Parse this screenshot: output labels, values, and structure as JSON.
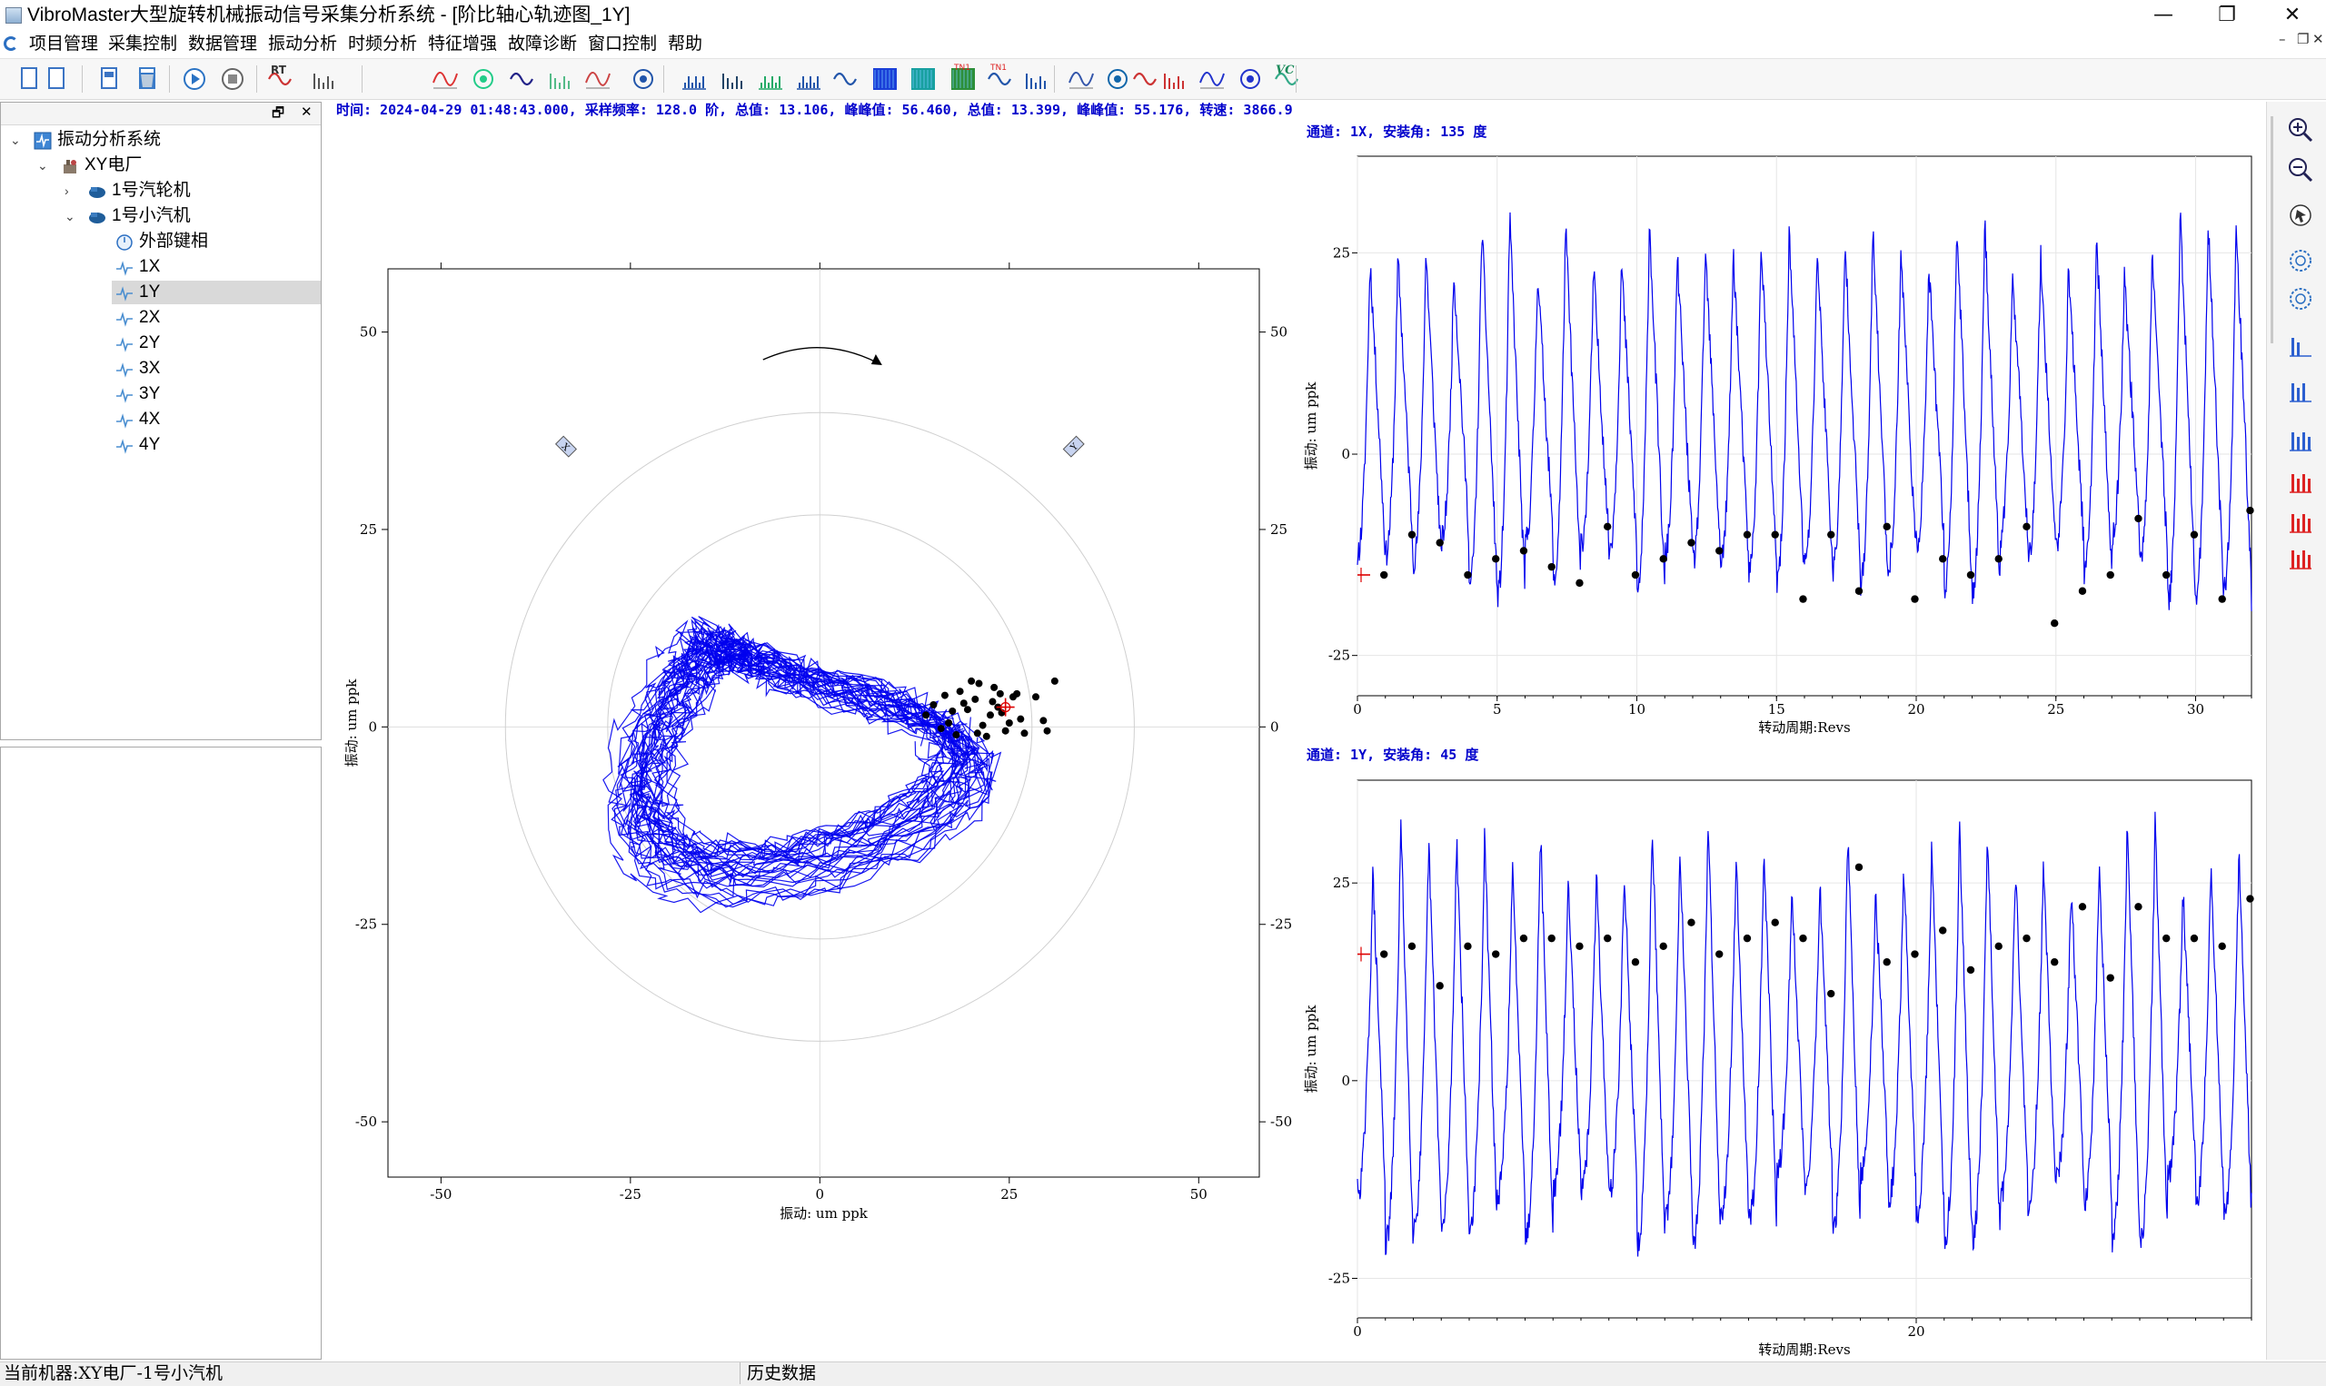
{
  "window": {
    "title": "VibroMaster大型旋转机械振动信号采集分析系统 - [阶比轴心轨迹图_1Y]",
    "minimize_glyph": "—",
    "restore_glyph": "❐",
    "close_glyph": "✕"
  },
  "menu": {
    "items": [
      "项目管理",
      "采集控制",
      "数据管理",
      "振动分析",
      "时频分析",
      "特征增强",
      "故障诊断",
      "窗口控制",
      "帮助"
    ],
    "mdi_minimize_glyph": "–",
    "mdi_restore_glyph": "❐",
    "mdi_close_glyph": "✕"
  },
  "toolbar": {
    "icons": [
      "new-project-icon",
      "open-project-icon",
      "save-icon",
      "delete-icon",
      "start-acquisition-icon",
      "stop-acquisition-icon",
      "realtime-icon",
      "history-icon",
      "trend-icon",
      "multi-trend-icon",
      "bode-icon",
      "polar-icon",
      "orbit-icon",
      "waveform-icon",
      "spectrum-icon",
      "waterfall-icon",
      "cascade-icon",
      "multi-spectrum-icon",
      "multi-waveform-icon",
      "stft-icon",
      "wavelet-icon",
      "spectrogram-icon",
      "order-waveform-icon",
      "order-spectrum-icon",
      "shaft-orbit-icon",
      "full-spectrum-icon",
      "filter-icon",
      "envelope-icon",
      "hilbert-icon",
      "cepstrum-icon",
      "vc-icon"
    ],
    "labels": {
      "rt": "RT",
      "vc": "VC",
      "order_wave": "TN1",
      "order_spec": "TN1"
    }
  },
  "tree": {
    "panel_float_glyph": "🗗",
    "panel_close_glyph": "✕",
    "nodes": [
      {
        "label": "振动分析系统",
        "level": 0,
        "expanded": true,
        "icon": "system-icon",
        "selected": false
      },
      {
        "label": "XY电厂",
        "level": 1,
        "expanded": true,
        "icon": "plant-icon",
        "selected": false
      },
      {
        "label": "1号汽轮机",
        "level": 2,
        "expanded": false,
        "icon": "machine-icon",
        "selected": false
      },
      {
        "label": "1号小汽机",
        "level": 2,
        "expanded": true,
        "icon": "machine-icon",
        "selected": false
      },
      {
        "label": "外部键相",
        "level": 3,
        "expanded": null,
        "icon": "keyphasor-icon",
        "selected": false
      },
      {
        "label": "1X",
        "level": 3,
        "expanded": null,
        "icon": "channel-icon",
        "selected": false
      },
      {
        "label": "1Y",
        "level": 3,
        "expanded": null,
        "icon": "channel-icon",
        "selected": true
      },
      {
        "label": "2X",
        "level": 3,
        "expanded": null,
        "icon": "channel-icon",
        "selected": false
      },
      {
        "label": "2Y",
        "level": 3,
        "expanded": null,
        "icon": "channel-icon",
        "selected": false
      },
      {
        "label": "3X",
        "level": 3,
        "expanded": null,
        "icon": "channel-icon",
        "selected": false
      },
      {
        "label": "3Y",
        "level": 3,
        "expanded": null,
        "icon": "channel-icon",
        "selected": false
      },
      {
        "label": "4X",
        "level": 3,
        "expanded": null,
        "icon": "channel-icon",
        "selected": false
      },
      {
        "label": "4Y",
        "level": 3,
        "expanded": null,
        "icon": "channel-icon",
        "selected": false
      }
    ]
  },
  "info_line": "时间: 2024-04-29 01:48:43.000, 采样频率: 128.0 阶, 总值: 13.106, 峰峰值: 56.460, 总值: 13.399, 峰峰值: 55.176, 转速: 3866.9",
  "status": {
    "machine": "当前机器:XY电厂-1号小汽机",
    "mode": "历史数据"
  },
  "colors": {
    "trace": "#0000ee",
    "keyphasor_dot": "#000000",
    "cursor": "#dd0000",
    "info_text": "#0000cc"
  },
  "chart_data": [
    {
      "type": "scatter",
      "name": "orbit",
      "xlabel": "振动: um ppk",
      "ylabel": "振动: um ppk",
      "xlim": [
        -57,
        58
      ],
      "ylim": [
        -57,
        58
      ],
      "xticks": [
        -50,
        -25,
        0,
        25,
        50
      ],
      "yticks": [
        -50,
        -25,
        0,
        25,
        50
      ],
      "grid_circles": [
        28,
        41.5
      ],
      "rotation_direction": "clockwise",
      "probe_labels": [
        "X",
        "Y"
      ],
      "revolutions": 32,
      "keyphasor_dots": [
        [
          20.5,
          3.5
        ],
        [
          22.5,
          1.5
        ],
        [
          17,
          0.5
        ],
        [
          18.5,
          4.5
        ],
        [
          23.5,
          2.5
        ],
        [
          26.5,
          1.0
        ],
        [
          21,
          5.5
        ],
        [
          24.5,
          -0.5
        ],
        [
          16,
          -0.2
        ],
        [
          19.5,
          2.2
        ],
        [
          25.5,
          3.8
        ],
        [
          22,
          -1.2
        ],
        [
          15,
          2.8
        ],
        [
          28.5,
          3.8
        ],
        [
          29.5,
          0.8
        ],
        [
          20,
          5.8
        ],
        [
          23,
          5.0
        ],
        [
          27,
          -0.8
        ],
        [
          24,
          1.8
        ],
        [
          18,
          -1.0
        ],
        [
          21.5,
          0.2
        ],
        [
          30,
          -0.5
        ],
        [
          14,
          1.5
        ],
        [
          19,
          3.0
        ],
        [
          26,
          4.2
        ],
        [
          22.8,
          3.2
        ],
        [
          17.5,
          2.0
        ],
        [
          25,
          0.5
        ],
        [
          20.8,
          -0.8
        ],
        [
          31,
          5.8
        ],
        [
          23.8,
          4.2
        ],
        [
          16.5,
          4.0
        ]
      ],
      "cursor": [
        24.5,
        2.5
      ]
    },
    {
      "type": "line",
      "name": "1X",
      "channel_label": "通道: 1X, 安装角: 135 度",
      "xlabel": "转动周期:Revs",
      "ylabel": "振动: um ppk",
      "xlim": [
        0,
        32
      ],
      "ylim": [
        -30,
        37
      ],
      "xticks": [
        0,
        5,
        10,
        15,
        20,
        25,
        30
      ],
      "yticks": [
        -25,
        0,
        25
      ],
      "revolutions": 32,
      "mean": 6,
      "amplitude": 20,
      "keyphasor_values": [
        -15,
        -10,
        -11,
        -15,
        -13,
        -12,
        -14,
        -16,
        -9,
        -15,
        -13,
        -11,
        -12,
        -10,
        -10,
        -18,
        -10,
        -17,
        -9,
        -18,
        -13,
        -15,
        -13,
        -9,
        -21,
        -17,
        -15,
        -8,
        -15,
        -10,
        -18,
        -7
      ]
    },
    {
      "type": "line",
      "name": "1Y",
      "channel_label": "通道: 1Y, 安装角: 45 度",
      "xlabel": "转动周期:Revs",
      "ylabel": "振动: um ppk",
      "xlim": [
        0,
        32
      ],
      "ylim": [
        -30,
        38
      ],
      "xticks": [
        0,
        20
      ],
      "yticks": [
        -25,
        0,
        25
      ],
      "revolutions": 32,
      "mean": 6,
      "amplitude": 22,
      "keyphasor_values": [
        16,
        17,
        12,
        17,
        16,
        18,
        18,
        17,
        18,
        15,
        17,
        20,
        16,
        18,
        20,
        18,
        11,
        27,
        15,
        16,
        19,
        14,
        17,
        18,
        15,
        22,
        13,
        22,
        18,
        18,
        17,
        23
      ]
    }
  ]
}
